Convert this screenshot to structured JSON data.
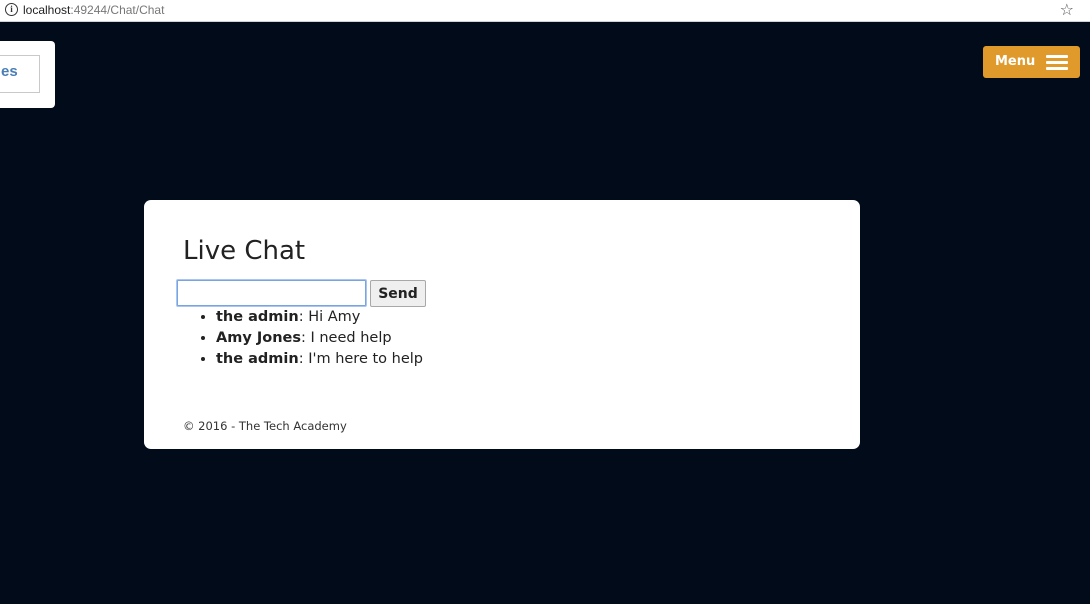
{
  "browser": {
    "url_host": "localhost",
    "url_path": ":49244/Chat/Chat",
    "info_icon": "info-icon",
    "bookmark_icon": "star-icon"
  },
  "side_card": {
    "text": "es"
  },
  "menu": {
    "label": "Menu",
    "icon": "hamburger-icon",
    "color": "#e09a2b"
  },
  "chat": {
    "title": "Live Chat",
    "input_value": "",
    "send_label": "Send",
    "messages": [
      {
        "sender": "the admin",
        "text": ": Hi Amy"
      },
      {
        "sender": "Amy Jones",
        "text": ": I need help"
      },
      {
        "sender": "the admin",
        "text": ": I'm here to help"
      }
    ],
    "footer": "© 2016 - The Tech Academy"
  },
  "colors": {
    "background": "#010b1a",
    "card": "#ffffff"
  }
}
